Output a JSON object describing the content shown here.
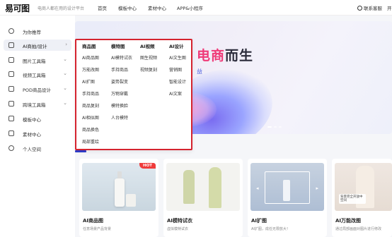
{
  "header": {
    "logo": "易可图",
    "slogan": "电商人都在用的设计平台",
    "nav": [
      "首页",
      "模板中心",
      "素材中心",
      "APP&小程序"
    ],
    "contact": "联系客服",
    "edge": "开"
  },
  "sidebar": {
    "items": [
      {
        "label": "为你推荐",
        "icon": "home-icon",
        "arrow": ""
      },
      {
        "label": "AI商拍/设计",
        "icon": "ai-icon",
        "arrow": "›"
      },
      {
        "label": "图片工具箱",
        "icon": "image-icon",
        "arrow": "⌄"
      },
      {
        "label": "视频工具箱",
        "icon": "video-icon",
        "arrow": "⌄"
      },
      {
        "label": "POD商品设计",
        "icon": "lock-icon",
        "arrow": "⌄"
      },
      {
        "label": "跨境工具箱",
        "icon": "box-icon",
        "arrow": "⌄"
      },
      {
        "label": "模板中心",
        "icon": "template-icon",
        "arrow": ""
      },
      {
        "label": "素材中心",
        "icon": "material-icon",
        "arrow": ""
      },
      {
        "label": "个人空间",
        "icon": "user-icon",
        "arrow": ""
      }
    ]
  },
  "banner": {
    "title_highlight": "电商",
    "title_rest": "而生",
    "subtitle": "益"
  },
  "dropdown": {
    "columns": [
      {
        "head": "商品图",
        "links": [
          "AI商品图",
          "万能改图",
          "AI扩图",
          "手持商品",
          "商品复刻",
          "AI相似图",
          "商品换色",
          "局部重绘"
        ]
      },
      {
        "head": "模特图",
        "links": [
          "AI模特试衣",
          "手持商品",
          "姿势裂变",
          "万物穿戴",
          "模特换脸",
          "人台模特"
        ]
      },
      {
        "head": "AI视频",
        "links": [
          "图生视频",
          "视频复刻"
        ]
      },
      {
        "head": "AI设计",
        "links": [
          "AI文生图",
          "营销图",
          "智能设计",
          "AI文案"
        ]
      }
    ]
  },
  "cards": [
    {
      "title": "AI商品图",
      "desc": "任意场景产品背景",
      "badge": "HOT"
    },
    {
      "title": "AI模特试衣",
      "desc": "虚拟模特试衣",
      "badge": ""
    },
    {
      "title": "AI扩图",
      "desc": "AI扩图，成任无限放大！",
      "badge": ""
    },
    {
      "title": "AI万能改图",
      "desc": "通过局部画面对图片进行修改",
      "badge": "",
      "overlay": "背景完全开放中 空间"
    }
  ],
  "colors": {
    "accent": "#d5232f",
    "brand_blue": "#2f3ccc",
    "banner_pink": "#ef3a78"
  }
}
